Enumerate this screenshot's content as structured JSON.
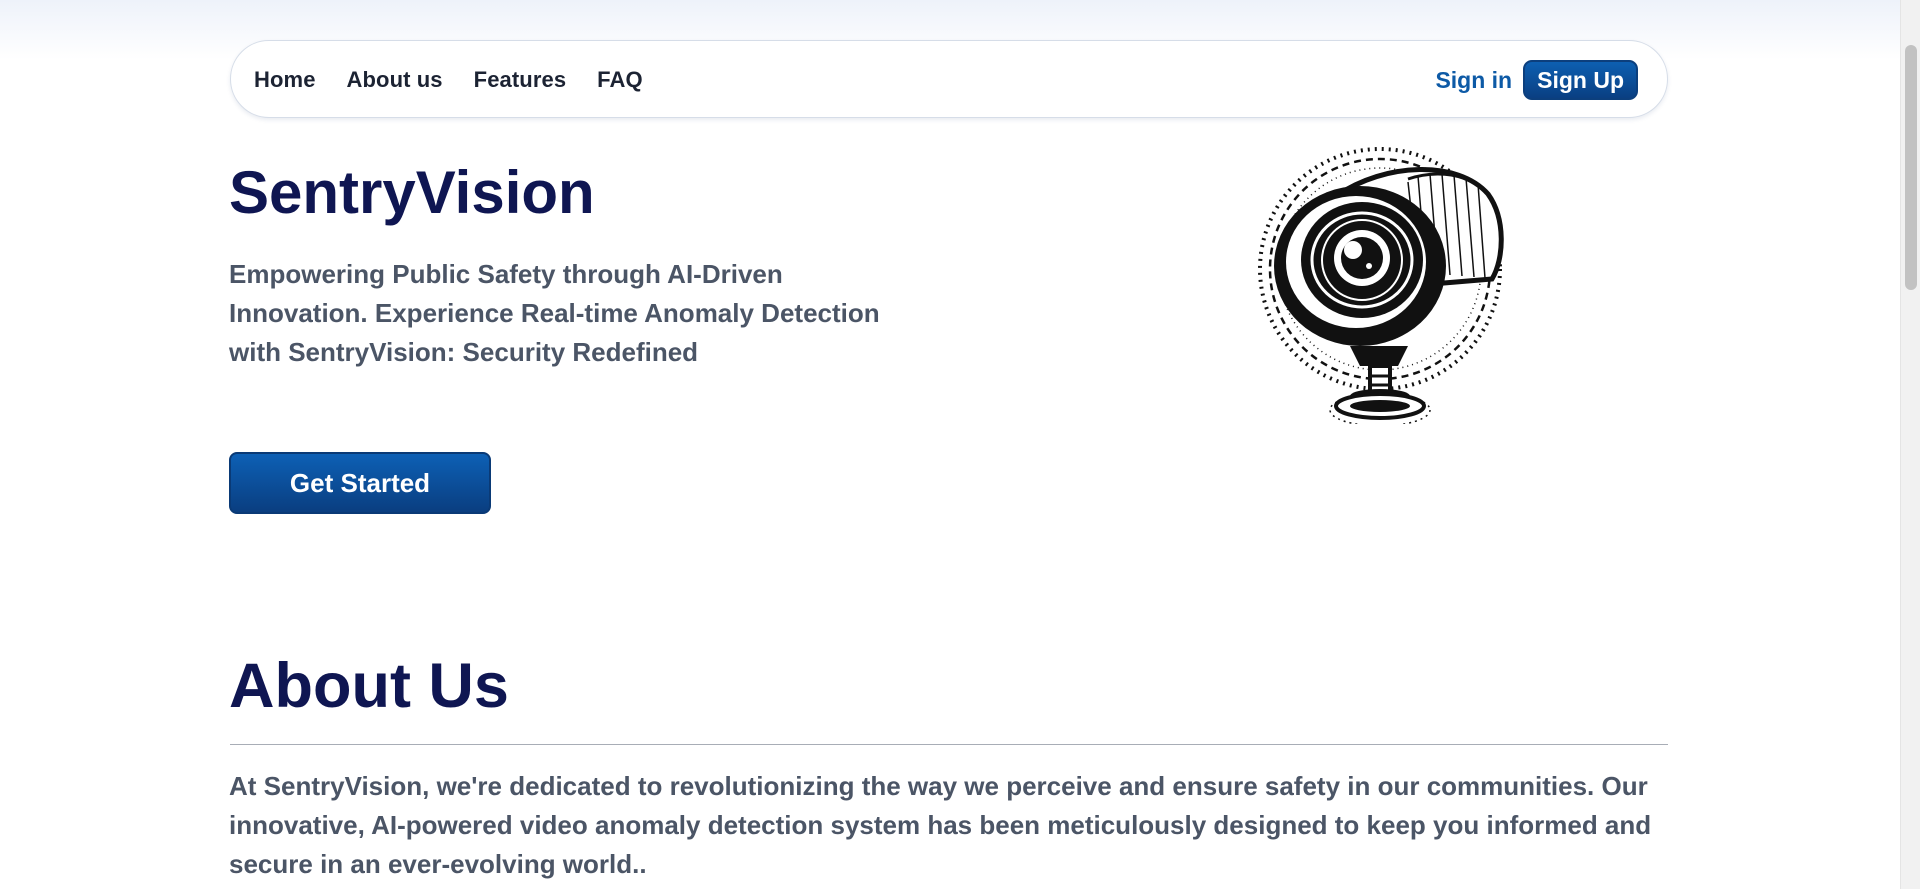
{
  "nav": {
    "links": [
      "Home",
      "About us",
      "Features",
      "FAQ"
    ],
    "signin": "Sign in",
    "signup": "Sign Up"
  },
  "hero": {
    "title": "SentryVision",
    "subtitle": "Empowering Public Safety through AI-Driven Innovation. Experience Real-time Anomaly Detection with SentryVision: Security Redefined",
    "cta": "Get Started",
    "image_icon": "security-camera-icon"
  },
  "about": {
    "title": "About Us",
    "text": "At SentryVision, we're dedicated to revolutionizing the way we perceive and ensure safety in our communities. Our innovative, AI-powered video anomaly detection system has been meticulously designed to keep you informed and secure in an ever-evolving world.."
  },
  "colors": {
    "primary": "#0d5aa6",
    "heading": "#0f1652",
    "body_text": "#4b5566"
  }
}
